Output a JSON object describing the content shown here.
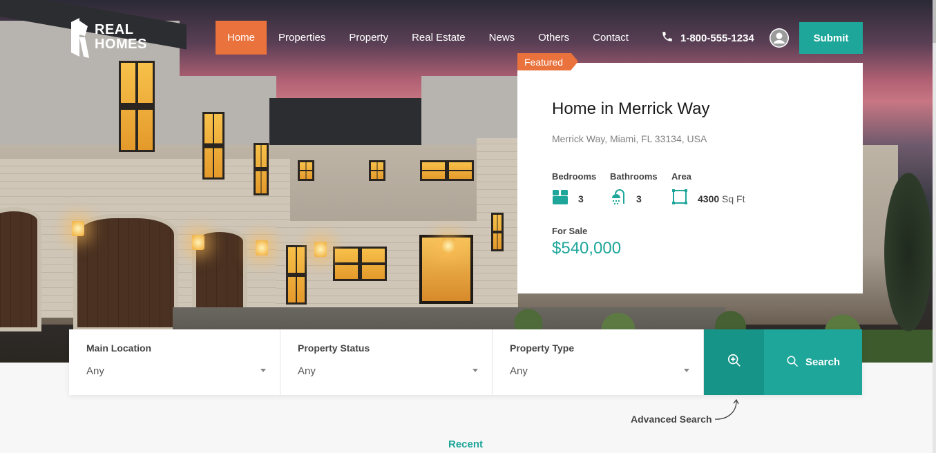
{
  "brand": {
    "line1": "REAL",
    "line2": "HOMES"
  },
  "nav": {
    "items": [
      {
        "label": "Home",
        "active": true
      },
      {
        "label": "Properties"
      },
      {
        "label": "Property"
      },
      {
        "label": "Real Estate"
      },
      {
        "label": "News"
      },
      {
        "label": "Others"
      },
      {
        "label": "Contact"
      }
    ],
    "phone": "1-800-555-1234",
    "submit_label": "Submit"
  },
  "featured": {
    "tag": "Featured",
    "title": "Home in Merrick Way",
    "address": "Merrick Way, Miami, FL 33134, USA",
    "bedrooms_label": "Bedrooms",
    "bedrooms": "3",
    "bathrooms_label": "Bathrooms",
    "bathrooms": "3",
    "area_label": "Area",
    "area": "4300",
    "area_unit": "Sq Ft",
    "status": "For Sale",
    "price": "$540,000"
  },
  "search": {
    "fields": [
      {
        "label": "Main Location",
        "value": "Any"
      },
      {
        "label": "Property Status",
        "value": "Any"
      },
      {
        "label": "Property Type",
        "value": "Any"
      }
    ],
    "search_label": "Search",
    "advanced_label": "Advanced Search"
  },
  "recent_label": "Recent",
  "colors": {
    "accent": "#1ea69a",
    "orange": "#ea723d"
  }
}
